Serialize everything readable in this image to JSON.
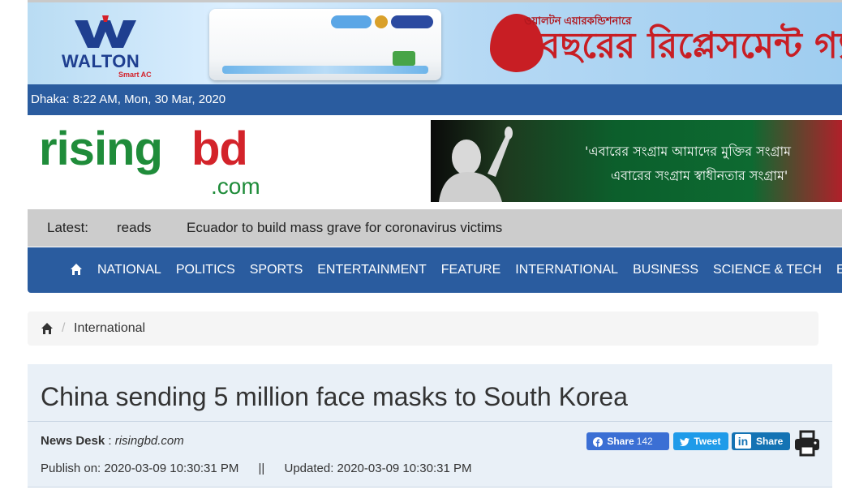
{
  "top_ad": {
    "brand": "WALTON",
    "brand_sub": "Smart AC",
    "small_text": "ওয়ালটন এয়ারকন্ডিশনারে",
    "headline": "বছরের রিপ্লেসমেন্ট গ্যারা"
  },
  "date_strip": {
    "text": "Dhaka: 8:22 AM, Mon, 30 Mar, 2020"
  },
  "logo": {
    "part1": "rising",
    "part2": "bd",
    "suffix": ".com"
  },
  "right_banner": {
    "line1": "'এবারের সংগ্রাম আমাদের মুক্তির সংগ্রাম",
    "line2": "এবারের সংগ্রাম স্বাধীনতার সংগ্রাম'"
  },
  "latest": {
    "label": "Latest:",
    "items": [
      "reads",
      "Ecuador to build mass grave for coronavirus victims"
    ]
  },
  "nav": {
    "home_icon": "home-icon",
    "items": [
      "NATIONAL",
      "POLITICS",
      "SPORTS",
      "ENTERTAINMENT",
      "FEATURE",
      "INTERNATIONAL",
      "BUSINESS",
      "SCIENCE & TECH",
      "EI"
    ]
  },
  "breadcrumb": {
    "separator": "/",
    "current": "International"
  },
  "article": {
    "title": "China sending 5 million face masks to South Korea",
    "author": "News Desk",
    "author_sep": " : ",
    "source": "risingbd.com",
    "publish_label": "Publish on: 2020-03-09 10:30:31 PM",
    "divider": "||",
    "updated_label": "Updated: 2020-03-09 10:30:31 PM"
  },
  "share": {
    "fb_label": "Share",
    "fb_count": "142",
    "tw_label": "Tweet",
    "li_logo": "in",
    "li_label": "Share"
  },
  "colors": {
    "nav_blue": "#2a5c9f",
    "logo_green": "#1f8c3a",
    "logo_red": "#d3232a",
    "fb_blue": "#3b6fd4",
    "tw_blue": "#1f9be9",
    "li_blue": "#1473b4"
  }
}
